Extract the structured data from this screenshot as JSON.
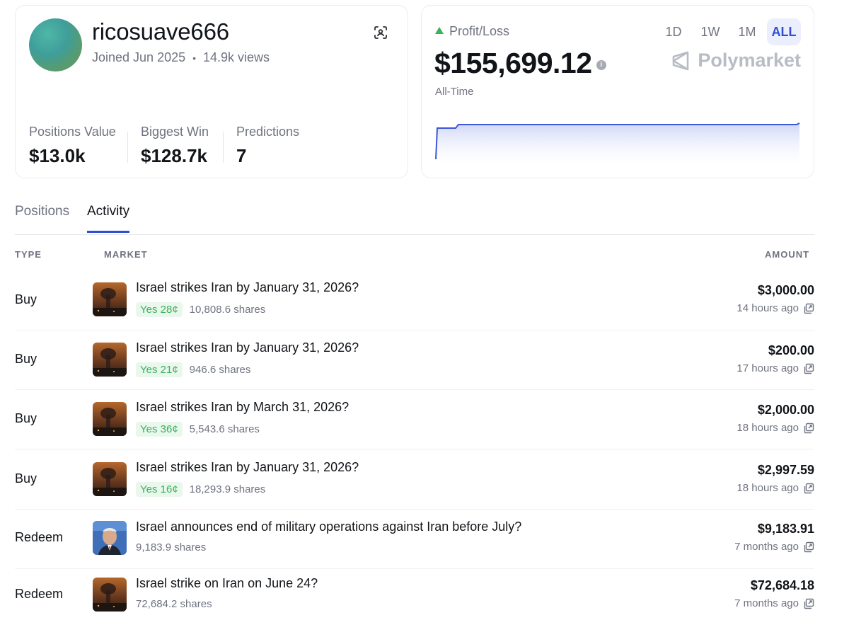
{
  "profile": {
    "username": "ricosuave666",
    "joined": "Joined Jun 2025",
    "views": "14.9k views",
    "stats": [
      {
        "label": "Positions Value",
        "value": "$13.0k"
      },
      {
        "label": "Biggest Win",
        "value": "$128.7k"
      },
      {
        "label": "Predictions",
        "value": "7"
      }
    ]
  },
  "pnl": {
    "label": "Profit/Loss",
    "value": "$155,699.12",
    "period": "All-Time",
    "brand": "Polymarket",
    "ranges": [
      "1D",
      "1W",
      "1M",
      "ALL"
    ],
    "active_range": "ALL",
    "accent_color": "#2c4fd4",
    "up_color": "#3bb25a"
  },
  "tabs": [
    "Positions",
    "Activity"
  ],
  "active_tab": "Activity",
  "table": {
    "headers": {
      "type": "TYPE",
      "market": "MARKET",
      "amount": "AMOUNT"
    },
    "rows": [
      {
        "type": "Buy",
        "title": "Israel strikes Iran by January 31, 2026?",
        "outcome": "Yes 28¢",
        "shares": "10,808.6 shares",
        "amount": "$3,000.00",
        "time": "14 hours ago",
        "thumb": "explosion"
      },
      {
        "type": "Buy",
        "title": "Israel strikes Iran by January 31, 2026?",
        "outcome": "Yes 21¢",
        "shares": "946.6 shares",
        "amount": "$200.00",
        "time": "17 hours ago",
        "thumb": "explosion"
      },
      {
        "type": "Buy",
        "title": "Israel strikes Iran by March 31, 2026?",
        "outcome": "Yes 36¢",
        "shares": "5,543.6 shares",
        "amount": "$2,000.00",
        "time": "18 hours ago",
        "thumb": "explosion"
      },
      {
        "type": "Buy",
        "title": "Israel strikes Iran by January 31, 2026?",
        "outcome": "Yes 16¢",
        "shares": "18,293.9 shares",
        "amount": "$2,997.59",
        "time": "18 hours ago",
        "thumb": "explosion"
      },
      {
        "type": "Redeem",
        "title": "Israel announces end of military operations against Iran before July?",
        "outcome": "",
        "shares": "9,183.9 shares",
        "amount": "$9,183.91",
        "time": "7 months ago",
        "thumb": "portrait"
      },
      {
        "type": "Redeem",
        "title": "Israel strike on Iran on June 24?",
        "outcome": "",
        "shares": "72,684.2 shares",
        "amount": "$72,684.18",
        "time": "7 months ago",
        "thumb": "explosion"
      }
    ]
  }
}
